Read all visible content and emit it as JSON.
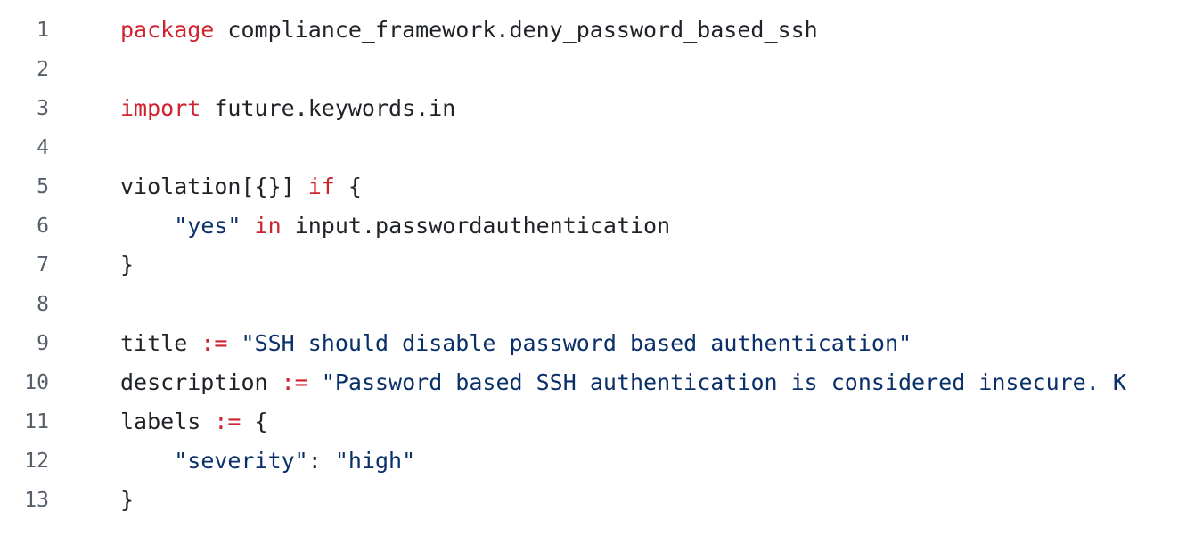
{
  "editor": {
    "lines": [
      {
        "number": "1",
        "tokens": [
          {
            "type": "keyword",
            "text": "package"
          },
          {
            "type": "plain",
            "text": " compliance_framework.deny_password_based_ssh"
          }
        ]
      },
      {
        "number": "2",
        "tokens": []
      },
      {
        "number": "3",
        "tokens": [
          {
            "type": "keyword",
            "text": "import"
          },
          {
            "type": "plain",
            "text": " future.keywords.in"
          }
        ]
      },
      {
        "number": "4",
        "tokens": []
      },
      {
        "number": "5",
        "tokens": [
          {
            "type": "plain",
            "text": "violation[{}] "
          },
          {
            "type": "keyword",
            "text": "if"
          },
          {
            "type": "plain",
            "text": " {"
          }
        ]
      },
      {
        "number": "6",
        "tokens": [
          {
            "type": "plain",
            "text": "    "
          },
          {
            "type": "string",
            "text": "\"yes\""
          },
          {
            "type": "plain",
            "text": " "
          },
          {
            "type": "keyword",
            "text": "in"
          },
          {
            "type": "plain",
            "text": " input.passwordauthentication"
          }
        ]
      },
      {
        "number": "7",
        "tokens": [
          {
            "type": "plain",
            "text": "}"
          }
        ]
      },
      {
        "number": "8",
        "tokens": []
      },
      {
        "number": "9",
        "tokens": [
          {
            "type": "plain",
            "text": "title "
          },
          {
            "type": "operator",
            "text": ":="
          },
          {
            "type": "plain",
            "text": " "
          },
          {
            "type": "string",
            "text": "\"SSH should disable password based authentication\""
          }
        ]
      },
      {
        "number": "10",
        "tokens": [
          {
            "type": "plain",
            "text": "description "
          },
          {
            "type": "operator",
            "text": ":="
          },
          {
            "type": "plain",
            "text": " "
          },
          {
            "type": "string",
            "text": "\"Password based SSH authentication is considered insecure. K"
          }
        ]
      },
      {
        "number": "11",
        "tokens": [
          {
            "type": "plain",
            "text": "labels "
          },
          {
            "type": "operator",
            "text": ":="
          },
          {
            "type": "plain",
            "text": " {"
          }
        ]
      },
      {
        "number": "12",
        "tokens": [
          {
            "type": "plain",
            "text": "    "
          },
          {
            "type": "string",
            "text": "\"severity\""
          },
          {
            "type": "plain",
            "text": ": "
          },
          {
            "type": "string",
            "text": "\"high\""
          }
        ]
      },
      {
        "number": "13",
        "tokens": [
          {
            "type": "plain",
            "text": "}"
          }
        ]
      }
    ]
  },
  "colors": {
    "keyword": "#cf222e",
    "string": "#0a3069",
    "plain": "#1f2328",
    "line_number": "#57606a",
    "background": "#ffffff"
  }
}
